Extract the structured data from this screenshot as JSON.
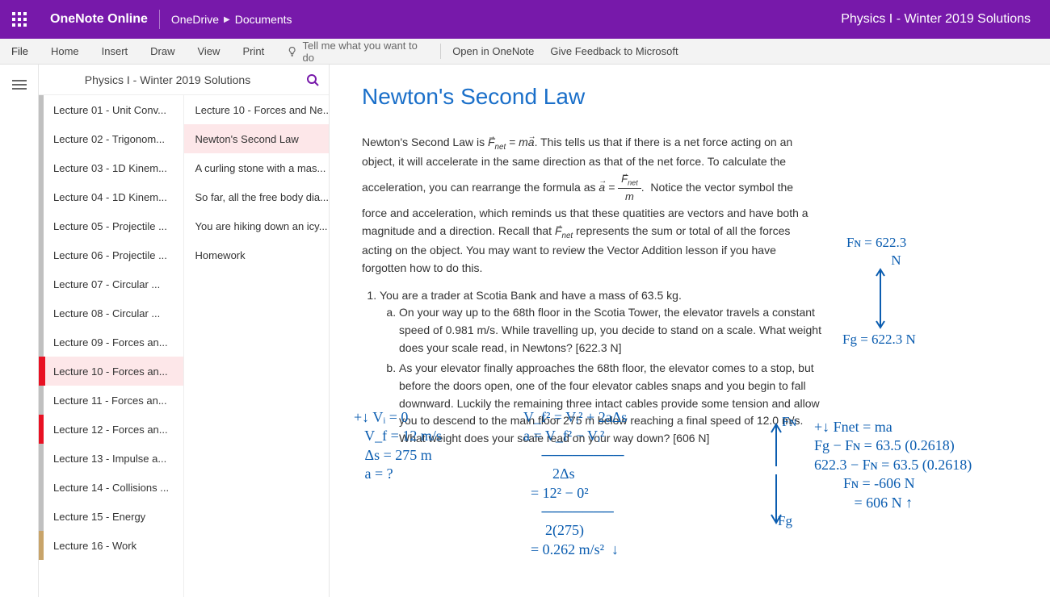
{
  "topbar": {
    "app_name": "OneNote Online",
    "breadcrumb": [
      "OneDrive",
      "Documents"
    ],
    "notebook_title": "Physics I - Winter 2019 Solutions"
  },
  "ribbon": {
    "tabs": [
      "File",
      "Home",
      "Insert",
      "Draw",
      "View",
      "Print"
    ],
    "tellme_placeholder": "Tell me what you want to do",
    "right_commands": [
      "Open in OneNote",
      "Give Feedback to Microsoft"
    ]
  },
  "nav": {
    "title": "Physics I - Winter 2019 Solutions",
    "sections": [
      {
        "label": "Lecture 01 - Unit Conv...",
        "color": "#c0c0c0"
      },
      {
        "label": "Lecture 02 - Trigonom...",
        "color": "#c0c0c0"
      },
      {
        "label": "Lecture 03 - 1D Kinem...",
        "color": "#c0c0c0"
      },
      {
        "label": "Lecture 04 - 1D Kinem...",
        "color": "#c0c0c0"
      },
      {
        "label": "Lecture 05 - Projectile ...",
        "color": "#c0c0c0"
      },
      {
        "label": "Lecture 06 - Projectile ...",
        "color": "#c0c0c0"
      },
      {
        "label": "Lecture 07 - Circular ...",
        "color": "#c0c0c0"
      },
      {
        "label": "Lecture 08 - Circular ...",
        "color": "#c0c0c0"
      },
      {
        "label": "Lecture 09 - Forces an...",
        "color": "#c0c0c0"
      },
      {
        "label": "Lecture 10 - Forces an...",
        "color": "#e81123",
        "selected": true
      },
      {
        "label": "Lecture 11 - Forces an...",
        "color": "#c0c0c0"
      },
      {
        "label": "Lecture 12 - Forces an...",
        "color": "#e81123"
      },
      {
        "label": "Lecture 13 - Impulse a...",
        "color": "#c0c0c0"
      },
      {
        "label": "Lecture 14 - Collisions ...",
        "color": "#c0c0c0"
      },
      {
        "label": "Lecture 15 - Energy",
        "color": "#c0c0c0"
      },
      {
        "label": "Lecture 16 - Work",
        "color": "#c8a46a"
      }
    ],
    "pages": [
      {
        "label": "Lecture 10 - Forces and Ne..."
      },
      {
        "label": "Newton's Second Law",
        "selected": true
      },
      {
        "label": "A curling stone with a mas..."
      },
      {
        "label": "So far, all the free body dia..."
      },
      {
        "label": "You are hiking down an icy..."
      },
      {
        "label": "Homework"
      }
    ]
  },
  "page": {
    "title": "Newton's Second Law",
    "intro_before": "Newton's Second Law is ",
    "formula1": "F⃗_net = ma⃗",
    "intro_mid": ". This tells us that if there is a net force acting on an object, it will accelerate in the same direction as that of the net force. To calculate the acceleration, you can rearrange the formula as ",
    "formula2": "a⃗ = F⃗_net / m",
    "intro_after": ".  Notice the vector symbol the force and acceleration, which reminds us that these quatities are vectors and have both a magnitude and a direction. Recall that F⃗_net represents the sum or total of all the forces acting on the object. You may want to review the Vector Addition lesson if you have forgotten how to do this.",
    "q1_stem": "You are a trader at Scotia Bank and have a mass of 63.5 kg.",
    "q1a": "On your way up to the 68th floor in the Scotia Tower, the elevator travels a constant speed of 0.981 m/s. While travelling up, you decide to stand on a scale. What weight does your scale read, in Newtons? [622.3 N]",
    "q1b": "As your elevator finally approaches the 68th floor, the elevator comes to a stop, but before the doors open, one of the four elevator cables snaps and you begin to fall downward. Luckily the remaining three intact cables provide some tension and allow you to descend to the main floor 275 m below reaching a final speed of 12.0 m/s. What weight does your scale read on your way down? [606 N]"
  },
  "ink": {
    "top_right_1": "Fɴ = 622.3\n             N",
    "top_right_2": "Fg = 622.3 N",
    "left_col": "+↓ Vᵢ = 0\n   V_f = 12 m/s\n   Δs = 275 m\n   a = ?",
    "mid_col": "V_f² = Vᵢ² + 2aΔs\na = V_f² − Vᵢ²\n     ────────\n        2Δs\n  = 12² − 0²\n     ───────\n      2(275)\n  = 0.262 m/s²  ↓",
    "right_col": "+↓ Fnet = ma\nFg − Fɴ = 63.5 (0.2618)\n622.3 − Fɴ = 63.5 (0.2618)\n        Fɴ = -606 N\n           = 606 N ↑",
    "fbd_top": "Fɴ",
    "fbd_bot": "Fg"
  }
}
